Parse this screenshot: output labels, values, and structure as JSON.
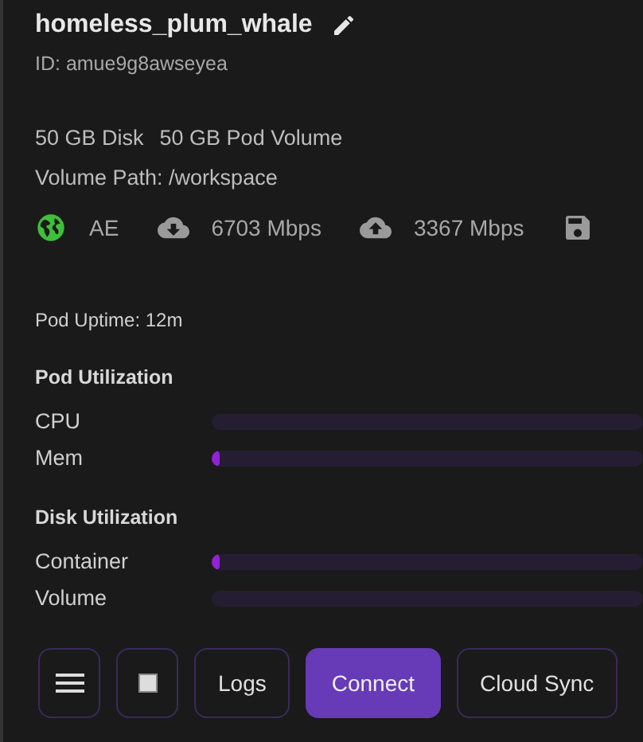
{
  "pod": {
    "name": "homeless_plum_whale",
    "id": "ID: amue9g8awseyea",
    "disk": "50 GB Disk",
    "volume": "50 GB Pod Volume",
    "volume_path": "Volume Path: /workspace"
  },
  "stats": [
    {
      "kind": "globe",
      "text": "AE"
    },
    {
      "kind": "download",
      "text": "6703 Mbps"
    },
    {
      "kind": "upload",
      "text": "3367 Mbps"
    },
    {
      "kind": "disk"
    }
  ],
  "uptime": "Pod Uptime: 12m",
  "sections": [
    {
      "title": "Pod Utilization",
      "meters": [
        {
          "name": "CPU"
        },
        {
          "name": "Mem",
          "level": 0.01
        }
      ]
    },
    {
      "title": "Disk Utilization",
      "meters": [
        {
          "name": "Container",
          "level": 0.01
        },
        {
          "name": "Volume"
        }
      ]
    }
  ],
  "buttons": [
    {
      "kind": "menu"
    },
    {
      "kind": "stop"
    },
    {
      "kind": "text",
      "label": "Logs",
      "primary": false
    },
    {
      "kind": "text",
      "label": "Connect",
      "primary": true
    },
    {
      "kind": "text",
      "label": "Cloud Sync",
      "primary": false
    }
  ]
}
